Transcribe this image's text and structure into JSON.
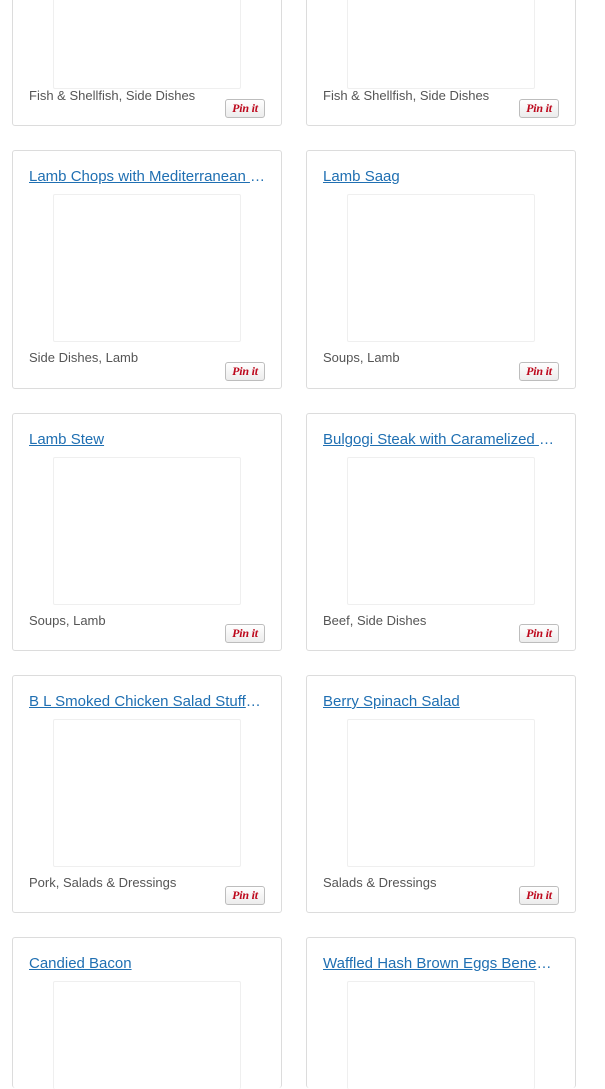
{
  "accent_color": "#1f6fb2",
  "pin_color": "#bd081c",
  "pin_label": "Pin it",
  "cards": [
    {
      "title": "",
      "categories": "Fish & Shellfish, Side Dishes"
    },
    {
      "title": "",
      "categories": "Fish & Shellfish, Side Dishes"
    },
    {
      "title": "Lamb Chops with Mediterranean Salsa",
      "categories": "Side Dishes, Lamb"
    },
    {
      "title": "Lamb Saag",
      "categories": "Soups, Lamb"
    },
    {
      "title": "Lamb Stew",
      "categories": "Soups, Lamb"
    },
    {
      "title": "Bulgogi Steak with Caramelized Onions",
      "categories": "Beef, Side Dishes"
    },
    {
      "title": "B L Smoked Chicken Salad Stuffed Tomatoes",
      "categories": "Pork, Salads & Dressings"
    },
    {
      "title": "Berry Spinach Salad",
      "categories": "Salads & Dressings"
    },
    {
      "title": "Candied Bacon",
      "categories": ""
    },
    {
      "title": "Waffled Hash Brown Eggs Benedict",
      "categories": ""
    }
  ]
}
